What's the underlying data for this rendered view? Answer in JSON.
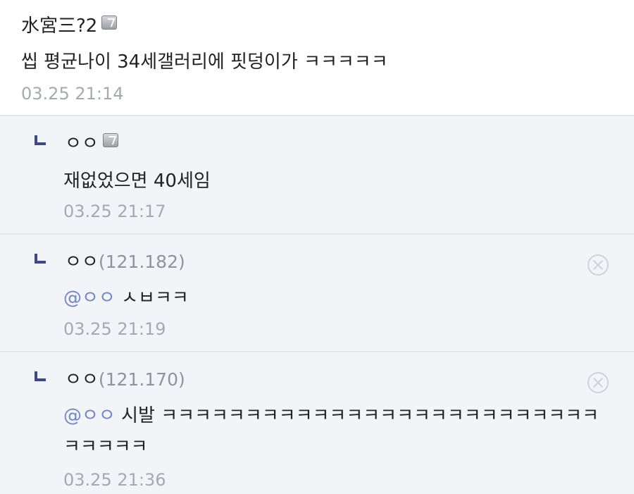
{
  "comments": [
    {
      "author": "水宮三?2",
      "text": "씹 평균나이 34세갤러리에 핏덩이가 ㅋㅋㅋㅋㅋ",
      "time": "03.25 21:14",
      "badge_icon": "gallery-nik-icon"
    }
  ],
  "replies": [
    {
      "author": "ㅇㅇ",
      "ip": "",
      "mention": "",
      "text": "재없었으면 40세임",
      "time": "03.25 21:17",
      "badge_icon": "gallery-nik-icon"
    },
    {
      "author": "ㅇㅇ",
      "ip": "(121.182)",
      "mention": "@ㅇㅇ",
      "text": "ㅅㅂㅋㅋ",
      "time": "03.25 21:19",
      "delete_icon": "delete-circle-x-icon"
    },
    {
      "author": "ㅇㅇ",
      "ip": "(121.170)",
      "mention": "@ㅇㅇ",
      "text": "시발 ㅋㅋㅋㅋㅋㅋㅋㅋㅋㅋㅋㅋㅋㅋㅋㅋㅋㅋㅋㅋㅋㅋㅋㅋㅋㅋㅋㅋㅋㅋㅋ",
      "time": "03.25 21:36",
      "delete_icon": "delete-circle-x-icon"
    }
  ],
  "colors": {
    "reply_background": "#f3f4f8",
    "divider": "#e4e6ec",
    "reply_arrow": "#3b4890",
    "mention": "#6f86c8",
    "timestamp": "#a6a9b0"
  }
}
